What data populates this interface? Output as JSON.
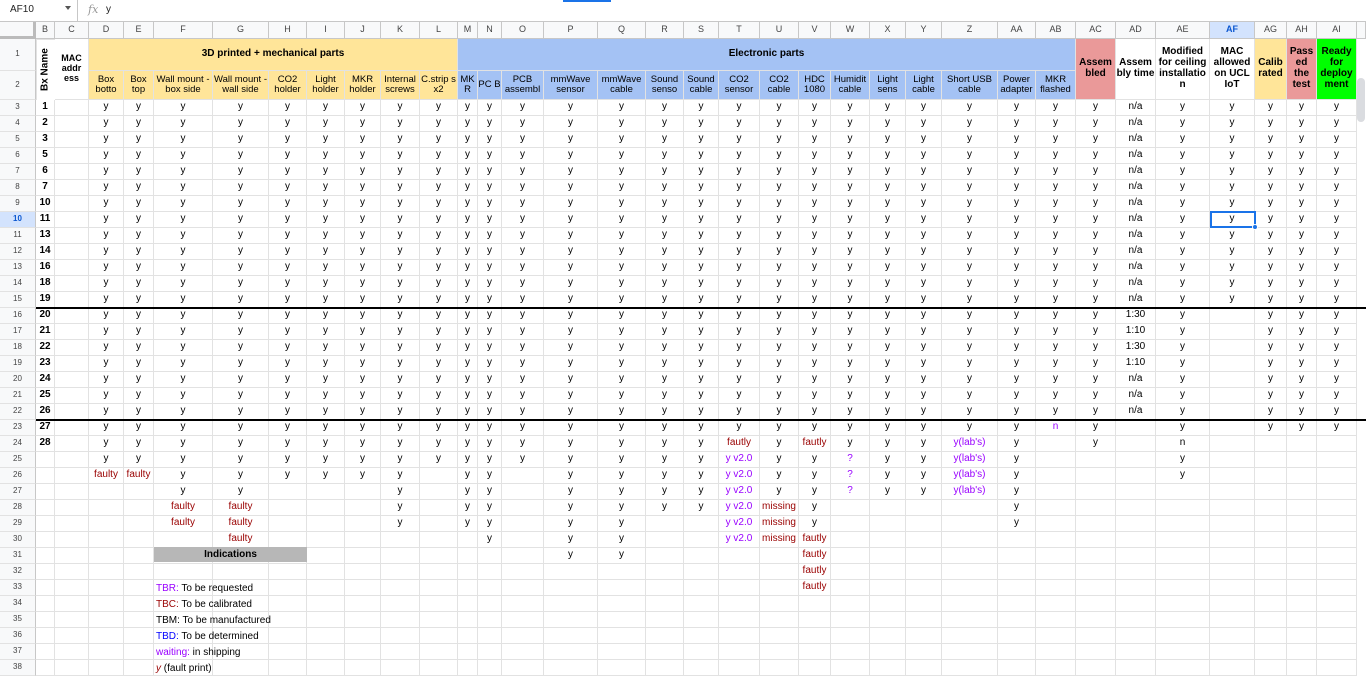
{
  "formula_bar": {
    "cell_ref": "AF10",
    "fx_icon": "fx",
    "value": "y"
  },
  "colors": {
    "mech_header": "#ffe599",
    "elec_header": "#a4c2f4",
    "assembled_header": "#ea9999",
    "calibrated_header": "#ffe599",
    "passed_header": "#ea9999",
    "ready_header": "#00ff00",
    "faulty_text": "#990000",
    "tbr_text": "#9900ff",
    "tbc_text": "#990000",
    "tbd_text": "#0000ff",
    "print_text": "#9900ff",
    "selection": "#1a73e8"
  },
  "columns": [
    "B",
    "C",
    "D",
    "E",
    "F",
    "G",
    "H",
    "I",
    "J",
    "K",
    "L",
    "M",
    "N",
    "O",
    "P",
    "Q",
    "R",
    "S",
    "T",
    "U",
    "V",
    "W",
    "X",
    "Y",
    "Z",
    "AA",
    "AB",
    "AC",
    "AD",
    "AE",
    "AF",
    "AG",
    "AH",
    "AI"
  ],
  "row_numbers": [
    "1",
    "2",
    "3",
    "4",
    "5",
    "6",
    "7",
    "8",
    "9",
    "10",
    "11",
    "12",
    "13",
    "14",
    "15",
    "16",
    "17",
    "18",
    "19",
    "20",
    "21",
    "22",
    "23",
    "24",
    "25",
    "26",
    "27",
    "28",
    "29",
    "30",
    "31",
    "32",
    "33",
    "34",
    "35",
    "36",
    "37",
    "38"
  ],
  "headers": {
    "bx_name": "Bx Name",
    "mac_address": "MAC addr ess",
    "mech_group": "3D printed + mechanical parts",
    "elec_group": "Electronic parts",
    "assembled": "Assem bled",
    "assembly_time": "Assem bly time",
    "modified_ceiling": "Modified for ceiling installatio n",
    "mac_allowed": "MAC allowed on UCL IoT",
    "calibrated": "Calib rated",
    "passed_test": "Pass ed the test",
    "ready_deploy": "Ready for deploy ment",
    "subheaders": [
      "Box botto",
      "Box top",
      "Wall mount - box side",
      "Wall mount - wall side",
      "CO2 holder",
      "Light holder",
      "MKR holder",
      "Internal screws",
      "C.strip s x2",
      "MK R",
      "PC B",
      "PCB assembl",
      "mmWave sensor",
      "mmWave cable",
      "Sound senso",
      "Sound cable",
      "CO2 sensor",
      "CO2 cable",
      "HDC 1080",
      "Humidit cable",
      "Light sens",
      "Light cable",
      "Short USB cable",
      "Power adapter",
      "MKR flashed"
    ]
  },
  "rows": [
    {
      "name": "1",
      "parts": [
        "y",
        "y",
        "y",
        "y",
        "y",
        "y",
        "y",
        "y",
        "y",
        "y",
        "y",
        "y",
        "y",
        "y",
        "y",
        "y",
        "y",
        "y",
        "y",
        "y",
        "y",
        "y",
        "y",
        "y",
        "y"
      ],
      "assembled": "y",
      "time": "n/a",
      "modified": "y",
      "mac": "y",
      "calibrated": "y",
      "passed": "y",
      "ready": "y"
    },
    {
      "name": "2",
      "parts": [
        "y",
        "y",
        "y",
        "y",
        "y",
        "y",
        "y",
        "y",
        "y",
        "y",
        "y",
        "y",
        "y",
        "y",
        "y",
        "y",
        "y",
        "y",
        "y",
        "y",
        "y",
        "y",
        "y",
        "y",
        "y"
      ],
      "assembled": "y",
      "time": "n/a",
      "modified": "y",
      "mac": "y",
      "calibrated": "y",
      "passed": "y",
      "ready": "y"
    },
    {
      "name": "3",
      "parts": [
        "y",
        "y",
        "y",
        "y",
        "y",
        "y",
        "y",
        "y",
        "y",
        "y",
        "y",
        "y",
        "y",
        "y",
        "y",
        "y",
        "y",
        "y",
        "y",
        "y",
        "y",
        "y",
        "y",
        "y",
        "y"
      ],
      "assembled": "y",
      "time": "n/a",
      "modified": "y",
      "mac": "y",
      "calibrated": "y",
      "passed": "y",
      "ready": "y"
    },
    {
      "name": "5",
      "parts": [
        "y",
        "y",
        "y",
        "y",
        "y",
        "y",
        "y",
        "y",
        "y",
        "y",
        "y",
        "y",
        "y",
        "y",
        "y",
        "y",
        "y",
        "y",
        "y",
        "y",
        "y",
        "y",
        "y",
        "y",
        "y"
      ],
      "assembled": "y",
      "time": "n/a",
      "modified": "y",
      "mac": "y",
      "calibrated": "y",
      "passed": "y",
      "ready": "y"
    },
    {
      "name": "6",
      "parts": [
        "y",
        "y",
        "y",
        "y",
        "y",
        "y",
        "y",
        "y",
        "y",
        "y",
        "y",
        "y",
        "y",
        "y",
        "y",
        "y",
        "y",
        "y",
        "y",
        "y",
        "y",
        "y",
        "y",
        "y",
        "y"
      ],
      "assembled": "y",
      "time": "n/a",
      "modified": "y",
      "mac": "y",
      "calibrated": "y",
      "passed": "y",
      "ready": "y"
    },
    {
      "name": "7",
      "parts": [
        "y",
        "y",
        "y",
        "y",
        "y",
        "y",
        "y",
        "y",
        "y",
        "y",
        "y",
        "y",
        "y",
        "y",
        "y",
        "y",
        "y",
        "y",
        "y",
        "y",
        "y",
        "y",
        "y",
        "y",
        "y"
      ],
      "assembled": "y",
      "time": "n/a",
      "modified": "y",
      "mac": "y",
      "calibrated": "y",
      "passed": "y",
      "ready": "y"
    },
    {
      "name": "10",
      "parts": [
        "y",
        "y",
        "y",
        "y",
        "y",
        "y",
        "y",
        "y",
        "y",
        "y",
        "y",
        "y",
        "y",
        "y",
        "y",
        "y",
        "y",
        "y",
        "y",
        "y",
        "y",
        "y",
        "y",
        "y",
        "y"
      ],
      "assembled": "y",
      "time": "n/a",
      "modified": "y",
      "mac": "y",
      "calibrated": "y",
      "passed": "y",
      "ready": "y"
    },
    {
      "name": "11",
      "parts": [
        "y",
        "y",
        "y",
        "y",
        "y",
        "y",
        "y",
        "y",
        "y",
        "y",
        "y",
        "y",
        "y",
        "y",
        "y",
        "y",
        "y",
        "y",
        "y",
        "y",
        "y",
        "y",
        "y",
        "y",
        "y"
      ],
      "assembled": "y",
      "time": "n/a",
      "modified": "y",
      "mac": "y",
      "calibrated": "y",
      "passed": "y",
      "ready": "y"
    },
    {
      "name": "13",
      "parts": [
        "y",
        "y",
        "y",
        "y",
        "y",
        "y",
        "y",
        "y",
        "y",
        "y",
        "y",
        "y",
        "y",
        "y",
        "y",
        "y",
        "y",
        "y",
        "y",
        "y",
        "y",
        "y",
        "y",
        "y",
        "y"
      ],
      "assembled": "y",
      "time": "n/a",
      "modified": "y",
      "mac": "y",
      "calibrated": "y",
      "passed": "y",
      "ready": "y"
    },
    {
      "name": "14",
      "parts": [
        "y",
        "y",
        "y",
        "y",
        "y",
        "y",
        "y",
        "y",
        "y",
        "y",
        "y",
        "y",
        "y",
        "y",
        "y",
        "y",
        "y",
        "y",
        "y",
        "y",
        "y",
        "y",
        "y",
        "y",
        "y"
      ],
      "assembled": "y",
      "time": "n/a",
      "modified": "y",
      "mac": "y",
      "calibrated": "y",
      "passed": "y",
      "ready": "y"
    },
    {
      "name": "16",
      "parts": [
        "y",
        "y",
        "y",
        "y",
        "y",
        "y",
        "y",
        "y",
        "y",
        "y",
        "y",
        "y",
        "y",
        "y",
        "y",
        "y",
        "y",
        "y",
        "y",
        "y",
        "y",
        "y",
        "y",
        "y",
        "y"
      ],
      "assembled": "y",
      "time": "n/a",
      "modified": "y",
      "mac": "y",
      "calibrated": "y",
      "passed": "y",
      "ready": "y"
    },
    {
      "name": "18",
      "parts": [
        "y",
        "y",
        "y",
        "y",
        "y",
        "y",
        "y",
        "y",
        "y",
        "y",
        "y",
        "y",
        "y",
        "y",
        "y",
        "y",
        "y",
        "y",
        "y",
        "y",
        "y",
        "y",
        "y",
        "y",
        "y"
      ],
      "assembled": "y",
      "time": "n/a",
      "modified": "y",
      "mac": "y",
      "calibrated": "y",
      "passed": "y",
      "ready": "y"
    },
    {
      "name": "19",
      "parts": [
        "y",
        "y",
        "y",
        "y",
        "y",
        "y",
        "y",
        "y",
        "y",
        "y",
        "y",
        "y",
        "y",
        "y",
        "y",
        "y",
        "y",
        "y",
        "y",
        "y",
        "y",
        "y",
        "y",
        "y",
        "y"
      ],
      "assembled": "y",
      "time": "n/a",
      "modified": "y",
      "mac": "y",
      "calibrated": "y",
      "passed": "y",
      "ready": "y"
    },
    {
      "name": "20",
      "parts": [
        "y",
        "y",
        "y",
        "y",
        "y",
        "y",
        "y",
        "y",
        "y",
        "y",
        "y",
        "y",
        "y",
        "y",
        "y",
        "y",
        "y",
        "y",
        "y",
        "y",
        "y",
        "y",
        "y",
        "y",
        "y"
      ],
      "assembled": "y",
      "time": "1:30",
      "modified": "y",
      "mac": "",
      "calibrated": "y",
      "passed": "y",
      "ready": "y"
    },
    {
      "name": "21",
      "parts": [
        "y",
        "y",
        "y",
        "y",
        "y",
        "y",
        "y",
        "y",
        "y",
        "y",
        "y",
        "y",
        "y",
        "y",
        "y",
        "y",
        "y",
        "y",
        "y",
        "y",
        "y",
        "y",
        "y",
        "y",
        "y"
      ],
      "assembled": "y",
      "time": "1:10",
      "modified": "y",
      "mac": "",
      "calibrated": "y",
      "passed": "y",
      "ready": "y"
    },
    {
      "name": "22",
      "parts": [
        "y",
        "y",
        "y",
        "y",
        "y",
        "y",
        "y",
        "y",
        "y",
        "y",
        "y",
        "y",
        "y",
        "y",
        "y",
        "y",
        "y",
        "y",
        "y",
        "y",
        "y",
        "y",
        "y",
        "y",
        "y"
      ],
      "assembled": "y",
      "time": "1:30",
      "modified": "y",
      "mac": "",
      "calibrated": "y",
      "passed": "y",
      "ready": "y"
    },
    {
      "name": "23",
      "parts": [
        "y",
        "y",
        "y",
        "y",
        "y",
        "y",
        "y",
        "y",
        "y",
        "y",
        "y",
        "y",
        "y",
        "y",
        "y",
        "y",
        "y",
        "y",
        "y",
        "y",
        "y",
        "y",
        "y",
        "y",
        "y"
      ],
      "assembled": "y",
      "time": "1:10",
      "modified": "y",
      "mac": "",
      "calibrated": "y",
      "passed": "y",
      "ready": "y"
    },
    {
      "name": "24",
      "parts": [
        "y",
        "y",
        "y",
        "y",
        "y",
        "y",
        "y",
        "y",
        "y",
        "y",
        "y",
        "y",
        "y",
        "y",
        "y",
        "y",
        "y",
        "y",
        "y",
        "y",
        "y",
        "y",
        "y",
        "y",
        "y"
      ],
      "assembled": "y",
      "time": "n/a",
      "modified": "y",
      "mac": "",
      "calibrated": "y",
      "passed": "y",
      "ready": "y"
    },
    {
      "name": "25",
      "parts": [
        "y",
        "y",
        "y",
        "y",
        "y",
        "y",
        "y",
        "y",
        "y",
        "y",
        "y",
        "y",
        "y",
        "y",
        "y",
        "y",
        "y",
        "y",
        "y",
        "y",
        "y",
        "y",
        "y",
        "y",
        "y"
      ],
      "assembled": "y",
      "time": "n/a",
      "modified": "y",
      "mac": "",
      "calibrated": "y",
      "passed": "y",
      "ready": "y"
    },
    {
      "name": "26",
      "parts": [
        "y",
        "y",
        "y",
        "y",
        "y",
        "y",
        "y",
        "y",
        "y",
        "y",
        "y",
        "y",
        "y",
        "y",
        "y",
        "y",
        "y",
        "y",
        "y",
        "y",
        "y",
        "y",
        "y",
        "y",
        "y"
      ],
      "assembled": "y",
      "time": "n/a",
      "modified": "y",
      "mac": "",
      "calibrated": "y",
      "passed": "y",
      "ready": "y"
    },
    {
      "name": "27",
      "parts": [
        "y",
        "y",
        "y",
        "y",
        "y",
        "y",
        "y",
        "y",
        "y",
        "y",
        "y",
        "y",
        "y",
        "y",
        "y",
        "y",
        "y",
        "y",
        "y",
        "y",
        "y",
        "y",
        "y",
        "y",
        "n"
      ],
      "assembled": "y",
      "time": "",
      "modified": "y",
      "mac": "",
      "calibrated": "y",
      "passed": "y",
      "ready": "y"
    },
    {
      "name": "28",
      "parts": [
        "y",
        "y",
        "y",
        "y",
        "y",
        "y",
        "y",
        "y",
        "y",
        "y",
        "y",
        "y",
        "y",
        "y",
        "y",
        "y",
        "fautly",
        "y",
        "fautly",
        "y",
        "y",
        "y",
        "y(lab's)",
        "y",
        ""
      ],
      "assembled": "y",
      "time": "",
      "modified": "n",
      "mac": "",
      "calibrated": "",
      "passed": "",
      "ready": ""
    },
    {
      "name": "",
      "parts": [
        "y",
        "y",
        "y",
        "y",
        "y",
        "y",
        "y",
        "y",
        "y",
        "y",
        "y",
        "y",
        "y",
        "y",
        "y",
        "y",
        "y v2.0",
        "y",
        "y",
        "?",
        "y",
        "y",
        "y(lab's)",
        "y",
        ""
      ],
      "assembled": "",
      "time": "",
      "modified": "y",
      "mac": "",
      "calibrated": "",
      "passed": "",
      "ready": ""
    },
    {
      "name": "",
      "parts": [
        "faulty",
        "faulty",
        "y",
        "y",
        "y",
        "y",
        "y",
        "y",
        "",
        "y",
        "y",
        "",
        "y",
        "y",
        "y",
        "y",
        "y v2.0",
        "y",
        "y",
        "?",
        "y",
        "y",
        "y(lab's)",
        "y",
        ""
      ],
      "assembled": "",
      "time": "",
      "modified": "y",
      "mac": "",
      "calibrated": "",
      "passed": "",
      "ready": ""
    },
    {
      "name": "",
      "parts": [
        "",
        "",
        "y",
        "y",
        "",
        "",
        "",
        "y",
        "",
        "y",
        "y",
        "",
        "y",
        "y",
        "y",
        "y",
        "y v2.0",
        "y",
        "y",
        "?",
        "y",
        "y",
        "y(lab's)",
        "y",
        ""
      ],
      "assembled": "",
      "time": "",
      "modified": "",
      "mac": "",
      "calibrated": "",
      "passed": "",
      "ready": ""
    },
    {
      "name": "",
      "parts": [
        "",
        "",
        "faulty",
        "faulty",
        "",
        "",
        "",
        "y",
        "",
        "y",
        "y",
        "",
        "y",
        "y",
        "y",
        "y",
        "y v2.0",
        "missing",
        "y",
        "",
        "",
        "",
        "",
        "y",
        ""
      ],
      "assembled": "",
      "time": "",
      "modified": "",
      "mac": "",
      "calibrated": "",
      "passed": "",
      "ready": ""
    },
    {
      "name": "",
      "parts": [
        "",
        "",
        "faulty",
        "faulty",
        "",
        "",
        "",
        "y",
        "",
        "y",
        "y",
        "",
        "y",
        "y",
        "",
        "",
        "y v2.0",
        "missing",
        "y",
        "",
        "",
        "",
        "",
        "y",
        ""
      ],
      "assembled": "",
      "time": "",
      "modified": "",
      "mac": "",
      "calibrated": "",
      "passed": "",
      "ready": ""
    },
    {
      "name": "",
      "parts": [
        "",
        "",
        "",
        "faulty",
        "",
        "",
        "",
        "",
        "",
        "",
        "y",
        "",
        "y",
        "y",
        "",
        "",
        "y v2.0",
        "missing",
        "fautly",
        "",
        "",
        "",
        "",
        "",
        ""
      ],
      "assembled": "",
      "time": "",
      "modified": "",
      "mac": "",
      "calibrated": "",
      "passed": "",
      "ready": ""
    },
    {
      "name": "",
      "parts": [
        "",
        "",
        "",
        "",
        "",
        "",
        "",
        "",
        "",
        "",
        "",
        "",
        "y",
        "y",
        "",
        "",
        "",
        "",
        "fautly",
        "",
        "",
        "",
        "",
        "",
        ""
      ],
      "assembled": "",
      "time": "",
      "modified": "",
      "mac": "",
      "calibrated": "",
      "passed": "",
      "ready": ""
    },
    {
      "name": "",
      "parts": [
        "",
        "",
        "",
        "",
        "",
        "",
        "",
        "",
        "",
        "",
        "",
        "",
        "",
        "",
        "",
        "",
        "",
        "",
        "fautly",
        "",
        "",
        "",
        "",
        "",
        ""
      ],
      "assembled": "",
      "time": "",
      "modified": "",
      "mac": "",
      "calibrated": "",
      "passed": "",
      "ready": ""
    },
    {
      "name": "",
      "parts": [
        "",
        "",
        "",
        "",
        "",
        "",
        "",
        "",
        "",
        "",
        "",
        "",
        "",
        "",
        "",
        "",
        "",
        "",
        "fautly",
        "",
        "",
        "",
        "",
        "",
        ""
      ],
      "assembled": "",
      "time": "",
      "modified": "",
      "mac": "",
      "calibrated": "",
      "passed": "",
      "ready": ""
    }
  ],
  "indications": {
    "title": "Indications",
    "items": [
      {
        "code": "TBR:",
        "text": " To be requested",
        "color": "#9900ff"
      },
      {
        "code": "TBC:",
        "text": " To be calibrated",
        "color": "#990000"
      },
      {
        "code": "TBM:",
        "text": " To be manufactured",
        "color": "#000000"
      },
      {
        "code": "TBD:",
        "text": " To be determined",
        "color": "#0000ff"
      },
      {
        "code": "waiting:",
        "text": " in shipping",
        "color": "#9900ff"
      },
      {
        "code": "y",
        "text": " (fault print)",
        "color": "#990000"
      }
    ]
  }
}
